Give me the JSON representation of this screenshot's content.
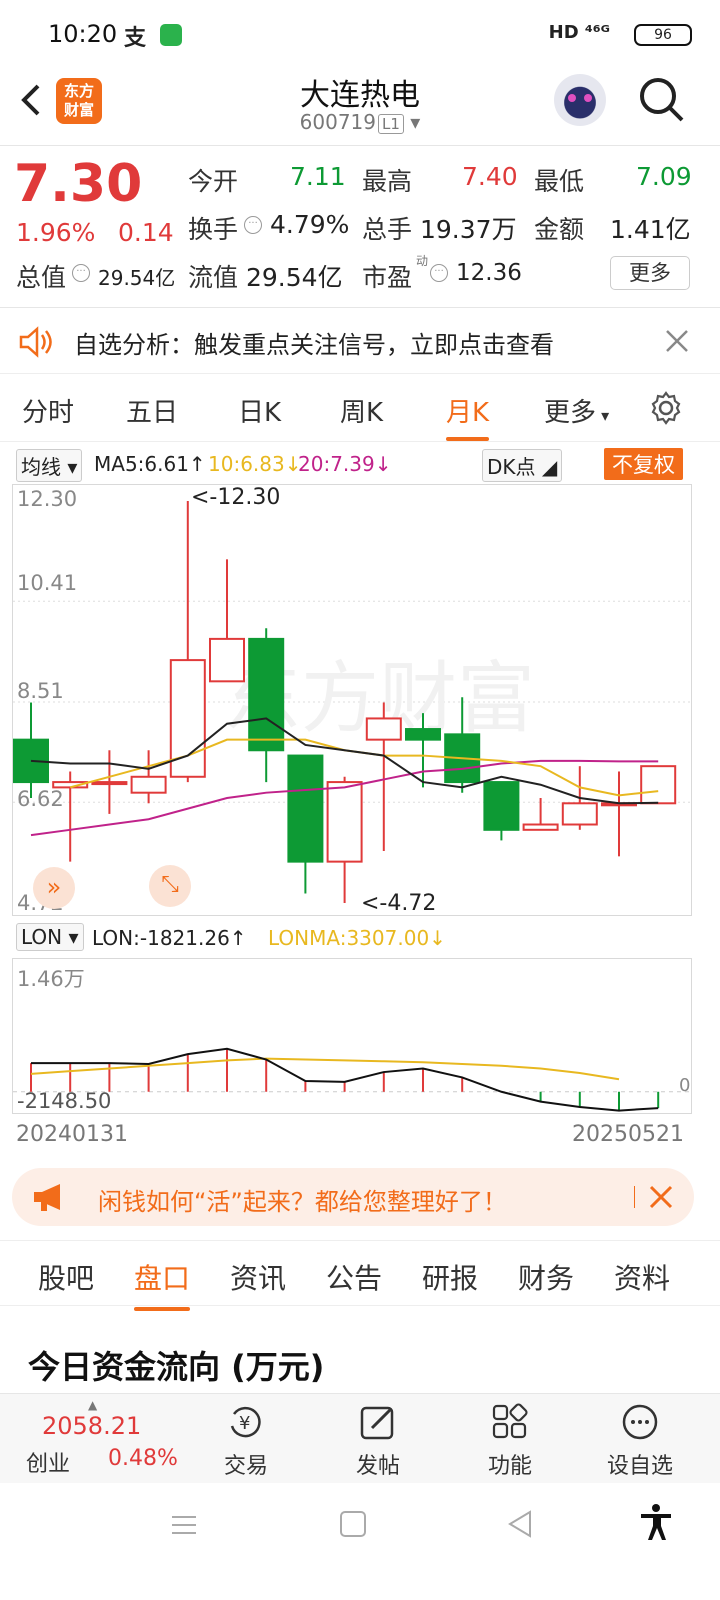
{
  "status": {
    "time": "10:20",
    "network": "HD ⁴⁶ᴳ",
    "battery": "96"
  },
  "header": {
    "title": "大连热电",
    "code": "600719",
    "level": "L1",
    "logo_line1": "东方",
    "logo_line2": "财富"
  },
  "quote": {
    "price": "7.30",
    "change_pct": "1.96%",
    "change": "0.14",
    "open_label": "今开",
    "open": "7.11",
    "high_label": "最高",
    "high": "7.40",
    "low_label": "最低",
    "low": "7.09",
    "turnover_label": "换手",
    "turnover": "4.79%",
    "volume_label": "总手",
    "volume": "19.37万",
    "amount_label": "金额",
    "amount": "1.41亿",
    "mktcap_label": "总值",
    "mktcap": "29.54亿",
    "float_label": "流值",
    "float": "29.54亿",
    "pe_label": "市盈",
    "pe_sup": "动",
    "pe": "12.36",
    "more_button": "更多"
  },
  "alert": {
    "text": "自选分析：触发重点关注信号，立即点击查看"
  },
  "periods": [
    "分时",
    "五日",
    "日K",
    "周K",
    "月K",
    "更多"
  ],
  "ma": {
    "selector": "均线",
    "ma5": "MA5:6.61↑",
    "ma10": "10:6.83↓",
    "ma20": "20:7.39↓",
    "dk": "DK点",
    "adjust": "不复权"
  },
  "chart": {
    "y_labels": [
      "12.30",
      "10.41",
      "8.51",
      "6.62",
      "4.72"
    ],
    "high_mark": "<-12.30",
    "low_mark": "<-4.72",
    "lon_selector": "LON",
    "lon_value": "LON:-1821.26↑",
    "lonma_value": "LONMA:3307.00↓",
    "lon_top": "1.46万",
    "lon_bottom": "-2148.50",
    "lon_zero": "0",
    "date_start": "20240131",
    "date_end": "20250521"
  },
  "chart_data": {
    "type": "candlestick",
    "ylim": [
      4.72,
      12.3
    ],
    "candles": [
      {
        "open": 7.8,
        "close": 7.0,
        "high": 8.5,
        "low": 6.7
      },
      {
        "open": 6.9,
        "close": 7.0,
        "high": 7.2,
        "low": 5.5
      },
      {
        "open": 7.0,
        "close": 7.0,
        "high": 7.6,
        "low": 6.4
      },
      {
        "open": 6.8,
        "close": 7.1,
        "high": 7.6,
        "low": 6.6
      },
      {
        "open": 7.1,
        "close": 9.3,
        "high": 12.3,
        "low": 7.0
      },
      {
        "open": 8.9,
        "close": 9.7,
        "high": 11.2,
        "low": 8.9
      },
      {
        "open": 9.7,
        "close": 7.6,
        "high": 9.9,
        "low": 7.0
      },
      {
        "open": 7.5,
        "close": 5.5,
        "high": 7.5,
        "low": 4.9
      },
      {
        "open": 5.5,
        "close": 7.0,
        "high": 7.1,
        "low": 4.72
      },
      {
        "open": 7.8,
        "close": 8.2,
        "high": 8.5,
        "low": 5.7
      },
      {
        "open": 8.0,
        "close": 7.8,
        "high": 8.3,
        "low": 6.9
      },
      {
        "open": 7.9,
        "close": 7.0,
        "high": 8.6,
        "low": 6.8
      },
      {
        "open": 7.0,
        "close": 6.1,
        "high": 7.0,
        "low": 5.9
      },
      {
        "open": 6.1,
        "close": 6.2,
        "high": 6.7,
        "low": 6.1
      },
      {
        "open": 6.2,
        "close": 6.6,
        "high": 7.3,
        "low": 6.1
      },
      {
        "open": 6.6,
        "close": 6.6,
        "high": 7.2,
        "low": 5.6
      },
      {
        "open": 6.6,
        "close": 7.3,
        "high": 7.3,
        "low": 6.6
      }
    ],
    "ma5": [
      7.4,
      7.35,
      7.35,
      7.25,
      7.5,
      8.1,
      8.2,
      7.7,
      7.6,
      7.5,
      7.0,
      6.9,
      7.1,
      6.95,
      6.7,
      6.6,
      6.61
    ],
    "ma10": [
      null,
      6.9,
      7.1,
      7.3,
      7.5,
      7.8,
      7.8,
      7.8,
      7.6,
      7.5,
      7.5,
      7.45,
      7.4,
      7.3,
      6.9,
      6.75,
      6.83
    ],
    "ma20": [
      6.0,
      6.1,
      6.2,
      6.3,
      6.5,
      6.7,
      6.8,
      6.85,
      6.9,
      7.05,
      7.2,
      7.25,
      7.35,
      7.4,
      7.4,
      7.39,
      7.39
    ],
    "lon": [
      3200,
      3200,
      3200,
      3100,
      4200,
      4800,
      3600,
      1200,
      1100,
      2200,
      2600,
      1600,
      0,
      -1100,
      -1700,
      -2100,
      -1821.26
    ],
    "lonma": [
      2000,
      2300,
      2600,
      2900,
      3200,
      3500,
      3700,
      3600,
      3500,
      3400,
      3300,
      3100,
      2900,
      2600,
      2100,
      1400,
      3307
    ],
    "lon_range": [
      -2148.5,
      14600
    ]
  },
  "banner": {
    "text": "闲钱如何“活”起来？都给您整理好了！"
  },
  "info_tabs": [
    "股吧",
    "盘口",
    "资讯",
    "公告",
    "研报",
    "财务",
    "资料"
  ],
  "section_title": "今日资金流向 (万元)",
  "bottom_nav": {
    "index_value": "2058.21",
    "index_name": "创业",
    "index_pct": "0.48%",
    "trade": "交易",
    "post": "发帖",
    "functions": "功能",
    "add_watch": "设自选"
  },
  "colors": {
    "accent": "#f26c1a",
    "up": "#e03a3a",
    "down": "#0d9a34",
    "ma5": "#222222",
    "ma10": "#e8b820",
    "ma20": "#c0228a"
  }
}
